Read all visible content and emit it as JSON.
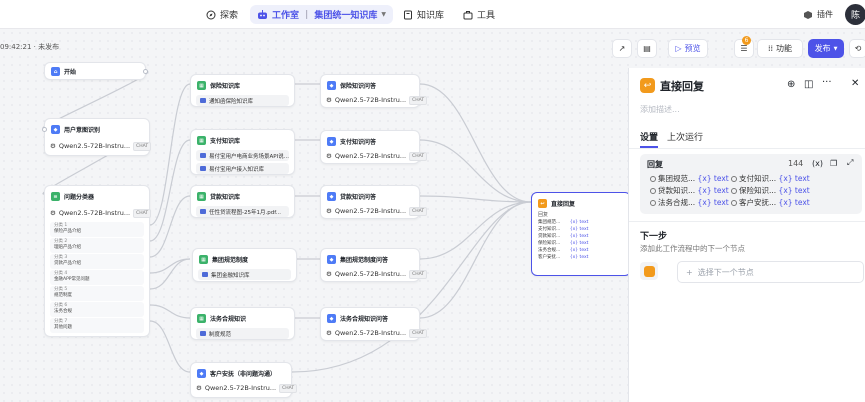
{
  "topbar": {
    "explore": "探索",
    "studio": "工作室",
    "workspace": "集团统一知识库",
    "knowledge": "知识库",
    "tools": "工具",
    "plugins": "插件",
    "avatar": "陈"
  },
  "toolbar": {
    "meta": "09:42:21 · 未发布",
    "preview": "预览",
    "badge": "6",
    "functions": "功能",
    "publish": "发布"
  },
  "nodes": {
    "start": {
      "title": "开始"
    },
    "intent": {
      "title": "用户意图识别",
      "model": "Qwen2.5-72B-Instru...",
      "tag": "CHAT"
    },
    "classifier": {
      "title": "问题分类器",
      "model": "Qwen2.5-72B-Instru...",
      "tag": "CHAT",
      "classes": [
        {
          "name": "分类 1",
          "desc": "保险产品介绍"
        },
        {
          "name": "分类 2",
          "desc": "理赔产品介绍"
        },
        {
          "name": "分类 3",
          "desc": "贷款产品介绍"
        },
        {
          "name": "分类 4",
          "desc": "金融APP常见问题"
        },
        {
          "name": "分类 5",
          "desc": "规范制度"
        },
        {
          "name": "分类 6",
          "desc": "法务合规"
        },
        {
          "name": "分类 7",
          "desc": "其他问题"
        }
      ]
    },
    "kb1": {
      "title": "保险知识库",
      "items": [
        "通知函保险知识库"
      ]
    },
    "kb2": {
      "title": "支付知识库",
      "items": [
        "易付宝用户电商业务场景API说...",
        "易付宝用户接入知识库"
      ]
    },
    "kb3": {
      "title": "贷款知识库",
      "items": [
        "任性贷流程图-25年1月.pdf..."
      ]
    },
    "kb4": {
      "title": "集团规范制度",
      "items": [
        "集团金融知识库"
      ]
    },
    "kb5": {
      "title": "法务合规知识",
      "items": [
        "制度规范"
      ]
    },
    "kb6": {
      "title": "客户安抚（非问题沟通）",
      "model": "Qwen2.5-72B-Instru...",
      "tag": "CHAT"
    },
    "ans1": {
      "title": "保险知识问答",
      "model": "Qwen2.5-72B-Instru...",
      "tag": "CHAT"
    },
    "ans2": {
      "title": "支付知识问答",
      "model": "Qwen2.5-72B-Instru...",
      "tag": "CHAT"
    },
    "ans3": {
      "title": "贷款知识问答",
      "model": "Qwen2.5-72B-Instru...",
      "tag": "CHAT"
    },
    "ans4": {
      "title": "集团规范制度问答",
      "model": "Qwen2.5-72B-Instru...",
      "tag": "CHAT"
    },
    "ans5": {
      "title": "法务合规知识问答",
      "model": "Qwen2.5-72B-Instru...",
      "tag": "CHAT"
    },
    "reply": {
      "title": "直接回复",
      "label": "回复",
      "vars": [
        "集团规范...",
        "支付知识...",
        "贷款知识...",
        "保险知识...",
        "法务合规...",
        "客户安抚..."
      ],
      "xtext": "{x} text"
    }
  },
  "panel": {
    "title": "直接回复",
    "desc_placeholder": "添加描述...",
    "tab_settings": "设置",
    "tab_last_run": "上次运行",
    "reply_label": "回复",
    "char_count": "144",
    "vars": [
      {
        "name": "集团规范...",
        "type": "{x} text"
      },
      {
        "name": "支付知识...",
        "type": "{x} text"
      },
      {
        "name": "贷款知识...",
        "type": "{x} text"
      },
      {
        "name": "保险知识...",
        "type": "{x} text"
      },
      {
        "name": "法务合规...",
        "type": "{x} text"
      },
      {
        "name": "客户安抚...",
        "type": "{x} text"
      }
    ],
    "next_title": "下一步",
    "next_desc": "添加此工作流程中的下一个节点",
    "select_next": "选择下一个节点"
  },
  "colors": {
    "accent": "#4d53e8",
    "knowledge": "#3bb26a",
    "llm": "#4e7bf6",
    "reply": "#f29a1c"
  }
}
